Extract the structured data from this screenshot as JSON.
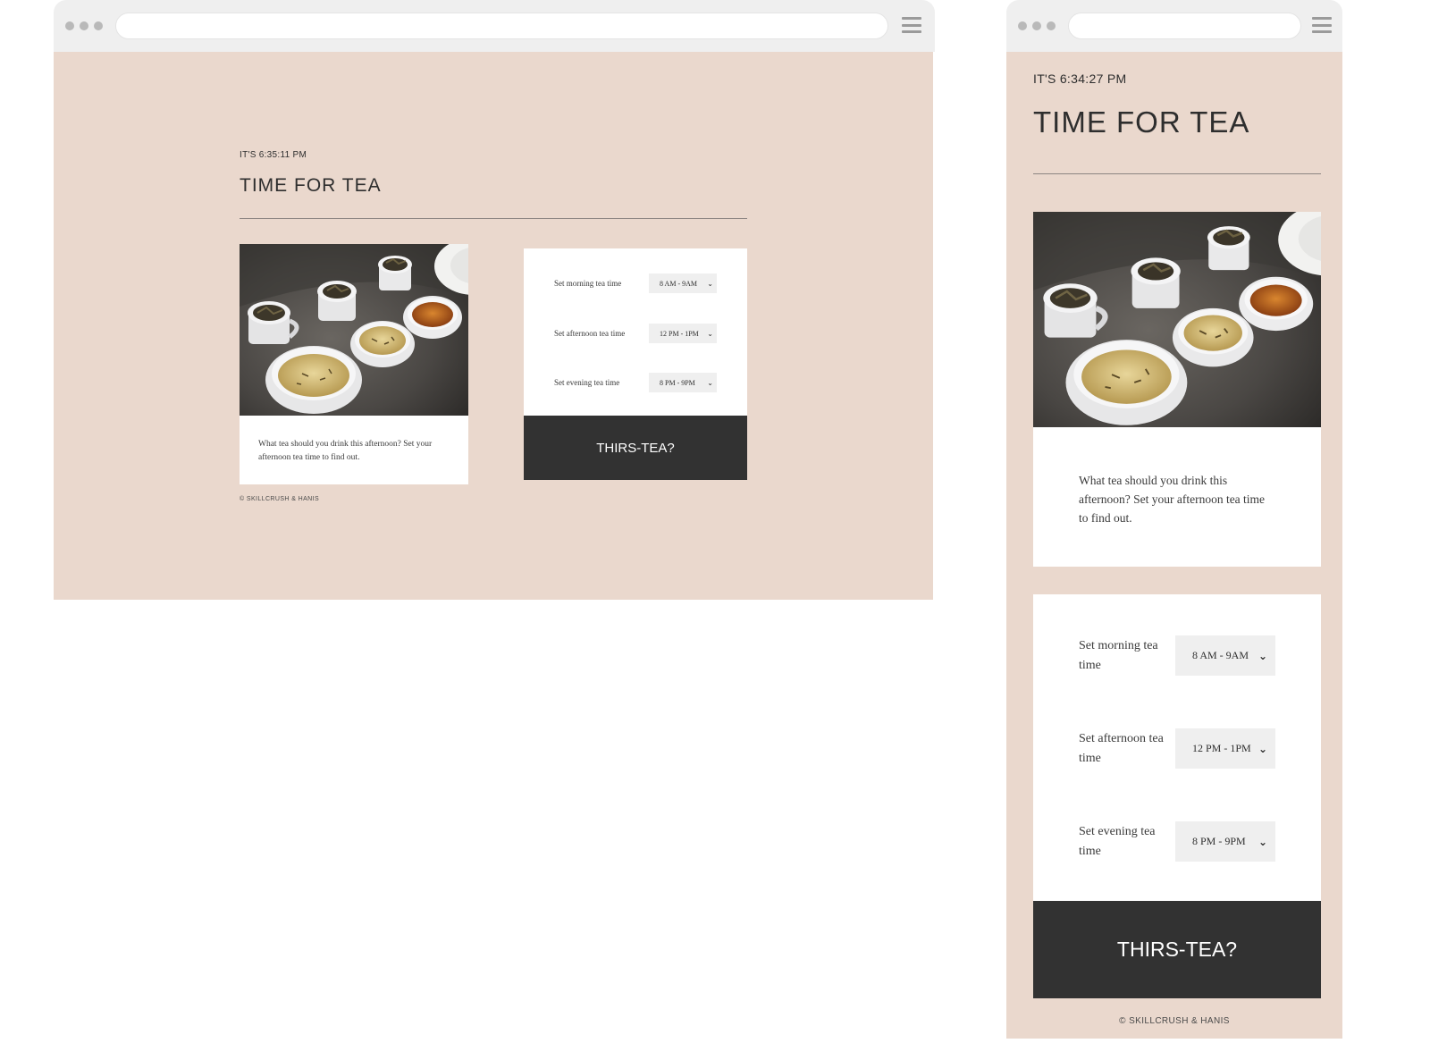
{
  "colors": {
    "page_background": "#ead8cd",
    "card_background": "#ffffff",
    "button_background": "#323232",
    "button_text": "#ffffff",
    "select_background": "#efefef",
    "chrome_background": "#efefef"
  },
  "icons": [
    "window-dots-icon",
    "hamburger-menu-icon",
    "chevron-down-icon"
  ],
  "desktop": {
    "clock": "IT'S 6:35:11 PM",
    "title": "TIME FOR TEA",
    "description": "What tea should you drink this afternoon? Set your afternoon tea time to find out.",
    "settings": [
      {
        "label": "Set morning tea time",
        "value": "8 AM - 9AM"
      },
      {
        "label": "Set afternoon tea time",
        "value": "12 PM - 1PM"
      },
      {
        "label": "Set evening tea time",
        "value": "8 PM - 9PM"
      }
    ],
    "button_label": "THIRS-TEA?",
    "footer": "© SKILLCRUSH & HANIS"
  },
  "mobile": {
    "clock": "IT'S 6:34:27 PM",
    "title": "TIME FOR TEA",
    "description": "What tea should you drink this afternoon? Set your afternoon tea time to find out.",
    "settings": [
      {
        "label": "Set morning tea time",
        "value": "8 AM - 9AM"
      },
      {
        "label": "Set afternoon tea time",
        "value": "12 PM - 1PM"
      },
      {
        "label": "Set evening tea time",
        "value": "8 PM - 9PM"
      }
    ],
    "button_label": "THIRS-TEA?",
    "footer": "© SKILLCRUSH & HANIS"
  }
}
